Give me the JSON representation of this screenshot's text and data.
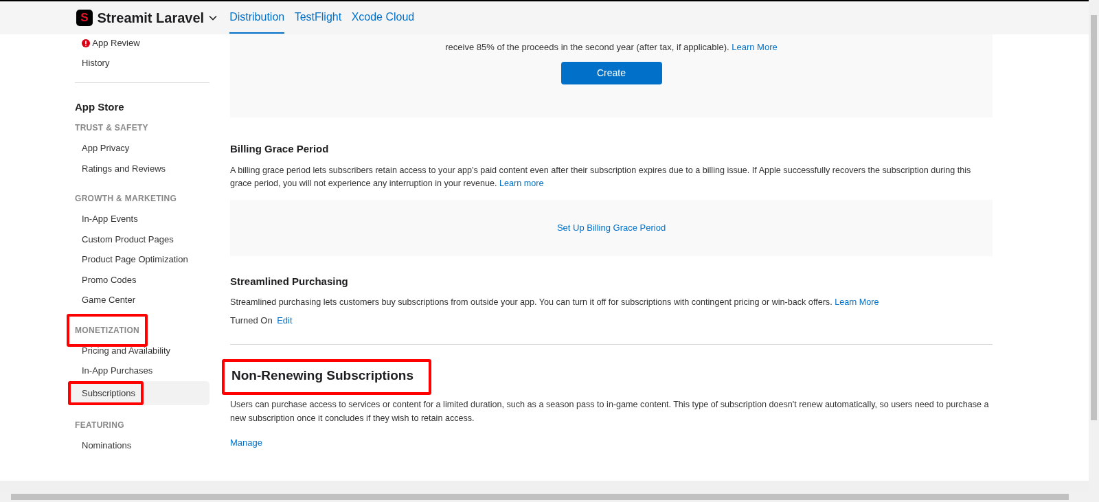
{
  "header": {
    "logo_text": "S",
    "app_name": "Streamit Laravel",
    "tabs": [
      {
        "label": "Distribution",
        "selected": true
      },
      {
        "label": "TestFlight",
        "selected": false
      },
      {
        "label": "Xcode Cloud",
        "selected": false
      }
    ]
  },
  "sidebar": {
    "top_items": [
      {
        "label": "App Review",
        "alert": true
      },
      {
        "label": "History",
        "alert": false
      }
    ],
    "heading": "App Store",
    "groups": [
      {
        "title": "TRUST & SAFETY",
        "highlighted": false,
        "items": [
          {
            "label": "App Privacy",
            "selected": false,
            "highlighted": false
          },
          {
            "label": "Ratings and Reviews",
            "selected": false,
            "highlighted": false
          }
        ]
      },
      {
        "title": "GROWTH & MARKETING",
        "highlighted": false,
        "items": [
          {
            "label": "In-App Events",
            "selected": false,
            "highlighted": false
          },
          {
            "label": "Custom Product Pages",
            "selected": false,
            "highlighted": false
          },
          {
            "label": "Product Page Optimization",
            "selected": false,
            "highlighted": false
          },
          {
            "label": "Promo Codes",
            "selected": false,
            "highlighted": false
          },
          {
            "label": "Game Center",
            "selected": false,
            "highlighted": false
          }
        ]
      },
      {
        "title": "MONETIZATION",
        "highlighted": true,
        "items": [
          {
            "label": "Pricing and Availability",
            "selected": false,
            "highlighted": false
          },
          {
            "label": "In-App Purchases",
            "selected": false,
            "highlighted": false
          },
          {
            "label": "Subscriptions",
            "selected": true,
            "highlighted": true
          }
        ]
      },
      {
        "title": "FEATURING",
        "highlighted": false,
        "items": [
          {
            "label": "Nominations",
            "selected": false,
            "highlighted": false
          }
        ]
      }
    ]
  },
  "intro": {
    "lines": [
      "receive 85% of the proceeds in the second year (after tax, if applicable)."
    ],
    "link": "Learn More",
    "button": "Create"
  },
  "sections": [
    {
      "kind": "panel",
      "title": "Billing Grace Period",
      "highlighted": false,
      "text": "A billing grace period lets subscribers retain access to your app's paid content even after their subscription expires due to a billing issue. If Apple successfully recovers the subscription during this grace period, you will not experience any interruption in your revenue.",
      "link": "Learn more",
      "action": "Set Up Billing Grace Period"
    },
    {
      "kind": "status",
      "title": "Streamlined Purchasing",
      "highlighted": false,
      "text": "Streamlined purchasing lets customers buy subscriptions from outside your app. You can turn it off for subscriptions with contingent pricing or win-back offers.",
      "link": "Learn More",
      "status": "Turned On",
      "action": "Edit"
    },
    {
      "kind": "manage",
      "title": "Non-Renewing Subscriptions",
      "highlighted": true,
      "text": "Users can purchase access to services or content for a limited duration, such as a season pass to in-game content. This type of subscription doesn't renew automatically, so users need to purchase a new subscription once it concludes if they wish to retain access.",
      "action": "Manage"
    }
  ]
}
